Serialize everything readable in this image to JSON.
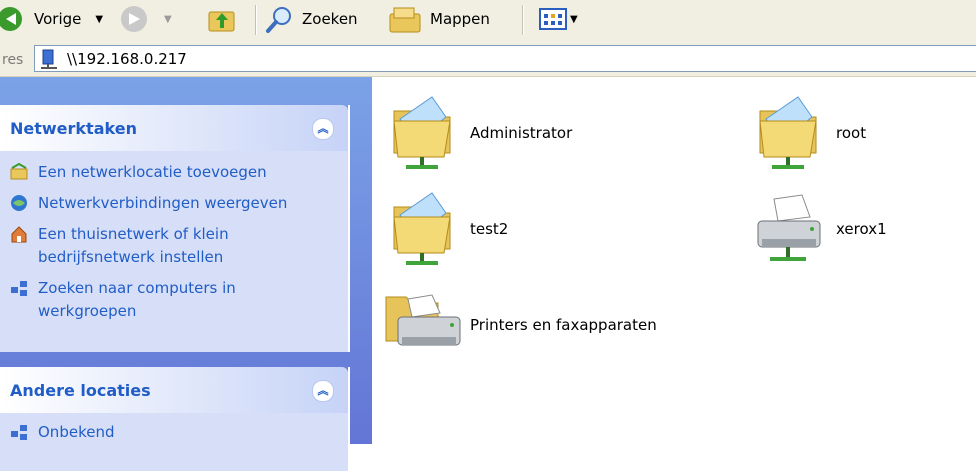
{
  "toolbar": {
    "back_label": "Vorige",
    "search_label": "Zoeken",
    "folders_label": "Mappen"
  },
  "address": {
    "label": "res",
    "value": "\\\\192.168.0.217"
  },
  "tasks_panel": {
    "title": "Netwerktaken",
    "items": [
      {
        "label": "Een netwerklocatie toevoegen"
      },
      {
        "label": "Netwerkverbindingen weergeven"
      },
      {
        "label": "Een thuisnetwerk of klein bedrijfsnetwerk instellen"
      },
      {
        "label": "Zoeken naar computers in werkgroepen"
      }
    ]
  },
  "other_panel": {
    "title": "Andere locaties",
    "items": [
      {
        "label": "Onbekend"
      }
    ]
  },
  "files": [
    {
      "label": "Administrator",
      "icon": "shared-folder-icon"
    },
    {
      "label": "root",
      "icon": "shared-folder-icon"
    },
    {
      "label": "test2",
      "icon": "shared-folder-icon"
    },
    {
      "label": "xerox1",
      "icon": "shared-printer-icon"
    },
    {
      "label": "Printers en faxapparaten",
      "icon": "printers-folder-icon"
    }
  ]
}
